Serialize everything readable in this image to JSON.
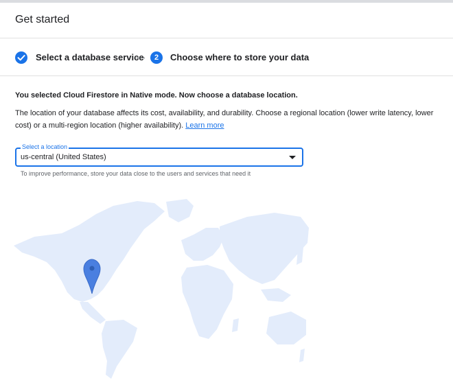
{
  "header": {
    "title": "Get started"
  },
  "stepper": {
    "step1_label": "Select a database service",
    "step2_number": "2",
    "step2_label": "Choose where to store your data"
  },
  "content": {
    "selected_text": "You selected Cloud Firestore in Native mode. Now choose a database location.",
    "description": "The location of your database affects its cost, availability, and durability. Choose a regional location (lower write latency, lower cost) or a multi-region location (higher availability).",
    "learn_more": "Learn more"
  },
  "location_select": {
    "label": "Select a location",
    "value": "us-central (United States)",
    "hint": "To improve performance, store your data close to the users and services that need it"
  },
  "colors": {
    "accent": "#1a73e8",
    "map_land": "#e3ecfb",
    "pin": "#4a7fe0"
  },
  "icons": {
    "step1": "check-circle-icon",
    "select": "dropdown-arrow-icon",
    "map_marker": "location-pin-icon"
  }
}
